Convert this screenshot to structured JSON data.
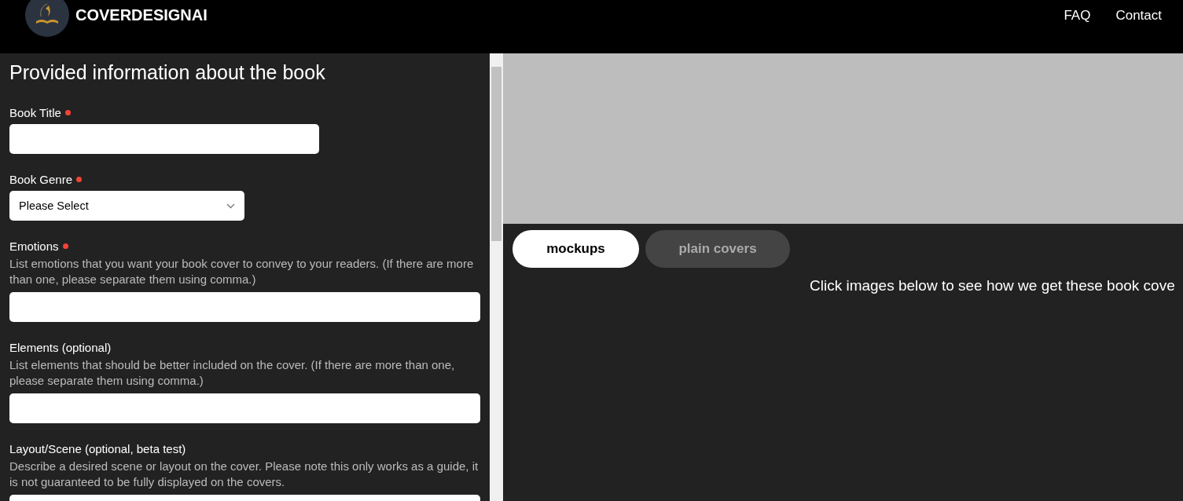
{
  "header": {
    "brand": "COVERDESIGNAI",
    "nav": [
      "FAQ",
      "Contact"
    ]
  },
  "form": {
    "title": "Provided information about the book",
    "fields": [
      {
        "kind": "text",
        "label": "Book Title",
        "required": true
      },
      {
        "kind": "select",
        "label": "Book Genre",
        "required": true,
        "value": "Please Select"
      },
      {
        "kind": "text",
        "label": "Emotions",
        "required": true,
        "hint": "List emotions that you want your book cover to convey to your readers. (If there are more than one, please separate them using comma.)"
      },
      {
        "kind": "text",
        "label": "Elements (optional)",
        "required": false,
        "hint": "List elements that should be better included on the cover. (If there are more than one, please separate them using comma.)"
      },
      {
        "kind": "text",
        "label": "Layout/Scene (optional, beta test)",
        "required": false,
        "hint": "Describe a desired scene or layout on the cover. Please note this only works as a guide, it is not guaranteed to be fully displayed on the covers."
      }
    ]
  },
  "preview": {
    "tabs": [
      {
        "label": "mockups",
        "selected": true
      },
      {
        "label": "plain covers",
        "selected": false
      }
    ],
    "note": "Click images below to see how we get these book cove"
  }
}
